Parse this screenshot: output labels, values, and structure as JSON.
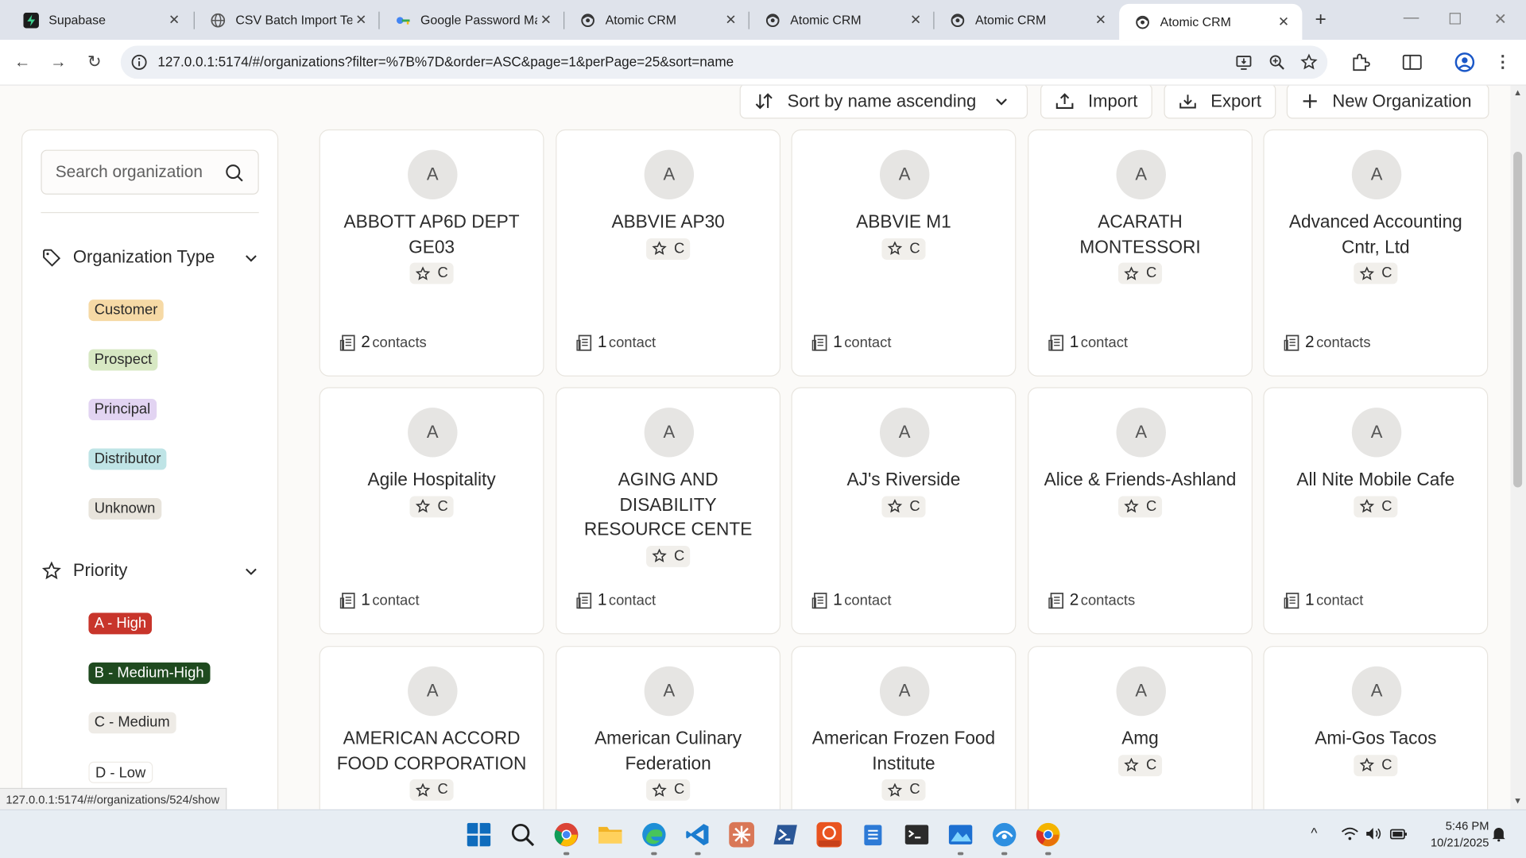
{
  "browser": {
    "tabs": [
      {
        "title": "Supabase",
        "icon": "supabase-icon",
        "active": false
      },
      {
        "title": "CSV Batch Import Tes",
        "icon": "globe-icon",
        "active": false
      },
      {
        "title": "Google Password Ma",
        "icon": "key-icon",
        "active": false
      },
      {
        "title": "Atomic CRM",
        "icon": "atomic-crm-icon",
        "active": false
      },
      {
        "title": "Atomic CRM",
        "icon": "atomic-crm-icon",
        "active": false
      },
      {
        "title": "Atomic CRM",
        "icon": "atomic-crm-icon",
        "active": false
      },
      {
        "title": "Atomic CRM",
        "icon": "atomic-crm-icon",
        "active": true
      }
    ],
    "url": "127.0.0.1:5174/#/organizations?filter=%7B%7D&order=ASC&page=1&perPage=25&sort=name",
    "status_url": "127.0.0.1:5174/#/organizations/524/show"
  },
  "toolbar": {
    "sort_label": "Sort by name ascending",
    "import_label": "Import",
    "export_label": "Export",
    "new_label": "New Organization"
  },
  "sidebar": {
    "search_placeholder": "Search organization",
    "org_type": {
      "title": "Organization Type",
      "items": [
        {
          "label": "Customer",
          "color": "#f6d9a5"
        },
        {
          "label": "Prospect",
          "color": "#d7e8c3"
        },
        {
          "label": "Principal",
          "color": "#e2d4f2"
        },
        {
          "label": "Distributor",
          "color": "#bfe4e6"
        },
        {
          "label": "Unknown",
          "color": "#e8e4dc"
        }
      ]
    },
    "priority": {
      "title": "Priority",
      "items": [
        {
          "label": "A - High",
          "color": "#c8352b",
          "text_color": "#ffffff"
        },
        {
          "label": "B - Medium-High",
          "color": "#1f4a1f",
          "text_color": "#ffffff"
        },
        {
          "label": "C - Medium",
          "color": "#eeebe6",
          "text_color": "#2b2b2b"
        },
        {
          "label": "D - Low",
          "color": "#ffffff",
          "text_color": "#2b2b2b"
        }
      ]
    }
  },
  "organizations": [
    {
      "avatar": "A",
      "name": "ABBOTT AP6D DEPT GE03",
      "priority": "C",
      "contacts_count": "2",
      "contacts_label": "contacts"
    },
    {
      "avatar": "A",
      "name": "ABBVIE AP30",
      "priority": "C",
      "contacts_count": "1",
      "contacts_label": "contact"
    },
    {
      "avatar": "A",
      "name": "ABBVIE M1",
      "priority": "C",
      "contacts_count": "1",
      "contacts_label": "contact"
    },
    {
      "avatar": "A",
      "name": "ACARATH MONTESSORI",
      "priority": "C",
      "contacts_count": "1",
      "contacts_label": "contact"
    },
    {
      "avatar": "A",
      "name": "Advanced Accounting Cntr, Ltd",
      "priority": "C",
      "contacts_count": "2",
      "contacts_label": "contacts"
    },
    {
      "avatar": "A",
      "name": "Agile Hospitality",
      "priority": "C",
      "contacts_count": "1",
      "contacts_label": "contact"
    },
    {
      "avatar": "A",
      "name": "AGING AND DISABILITY RESOURCE CENTE",
      "priority": "C",
      "contacts_count": "1",
      "contacts_label": "contact"
    },
    {
      "avatar": "A",
      "name": "AJ's Riverside",
      "priority": "C",
      "contacts_count": "1",
      "contacts_label": "contact"
    },
    {
      "avatar": "A",
      "name": "Alice & Friends-Ashland",
      "priority": "C",
      "contacts_count": "2",
      "contacts_label": "contacts"
    },
    {
      "avatar": "A",
      "name": "All Nite Mobile Cafe",
      "priority": "C",
      "contacts_count": "1",
      "contacts_label": "contact"
    },
    {
      "avatar": "A",
      "name": "AMERICAN ACCORD FOOD CORPORATION",
      "priority": "C",
      "contacts_count": "",
      "contacts_label": ""
    },
    {
      "avatar": "A",
      "name": "American Culinary Federation",
      "priority": "C",
      "contacts_count": "",
      "contacts_label": ""
    },
    {
      "avatar": "A",
      "name": "American Frozen Food Institute",
      "priority": "C",
      "contacts_count": "",
      "contacts_label": ""
    },
    {
      "avatar": "A",
      "name": "Amg",
      "priority": "C",
      "contacts_count": "",
      "contacts_label": ""
    },
    {
      "avatar": "A",
      "name": "Ami-Gos Tacos",
      "priority": "C",
      "contacts_count": "",
      "contacts_label": ""
    }
  ],
  "taskbar": {
    "time": "5:46 PM",
    "date": "10/21/2025",
    "apps": [
      "windows-start-icon",
      "search-icon",
      "chrome-icon",
      "file-explorer-icon",
      "edge-icon",
      "vscode-icon",
      "claude-icon",
      "powershell-icon",
      "ubuntu-icon",
      "notepad-icon",
      "terminal-icon",
      "photos-icon",
      "network-icon",
      "chrome-canary-icon"
    ]
  }
}
